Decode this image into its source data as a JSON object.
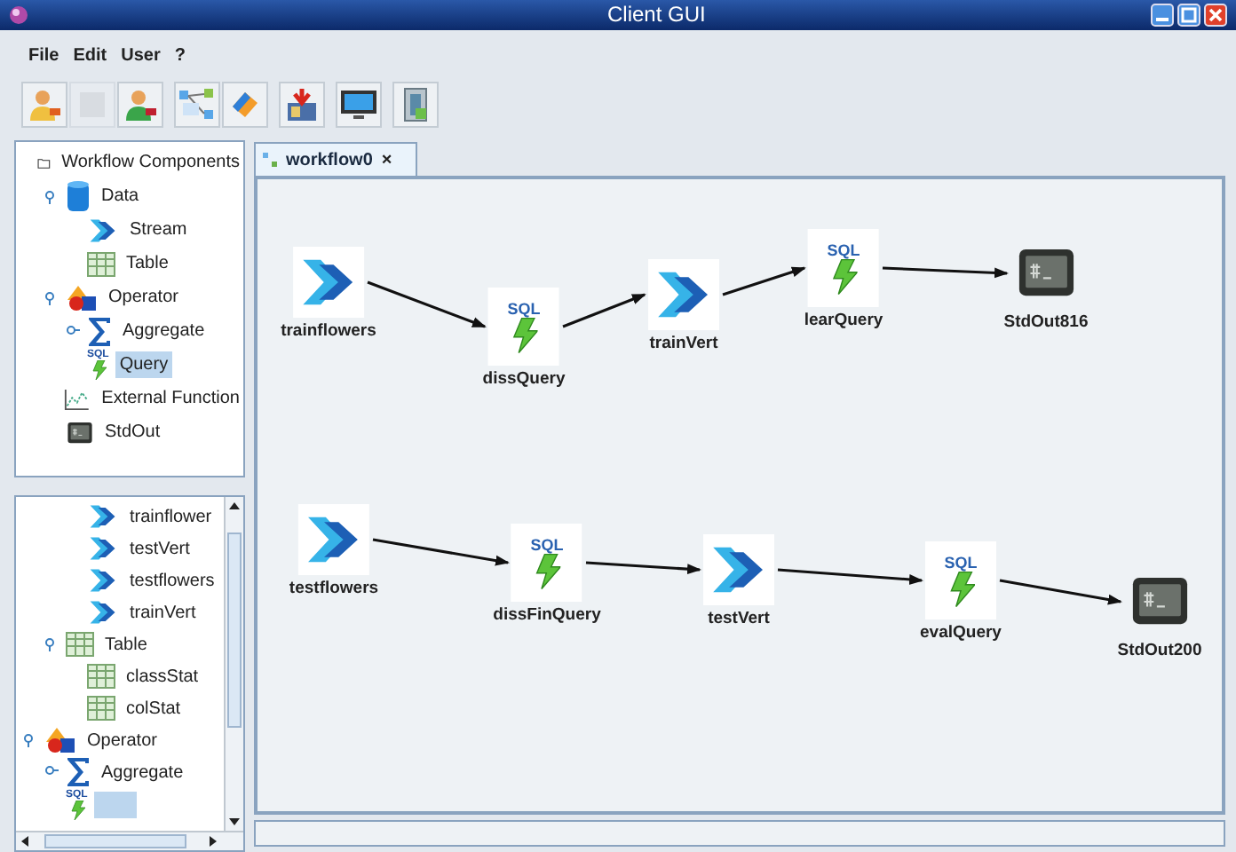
{
  "window": {
    "title": "Client GUI"
  },
  "menu": [
    "File",
    "Edit",
    "User",
    "?"
  ],
  "toolbar_groups": [
    {
      "buttons": [
        {
          "kind": "user-add",
          "disabled": false
        },
        {
          "kind": "blank",
          "disabled": true
        },
        {
          "kind": "user-remove",
          "disabled": false
        }
      ]
    },
    {
      "buttons": [
        {
          "kind": "workflow",
          "disabled": false
        },
        {
          "kind": "eraser",
          "disabled": false
        }
      ]
    },
    {
      "buttons": [
        {
          "kind": "import",
          "disabled": false
        }
      ]
    },
    {
      "buttons": [
        {
          "kind": "monitor",
          "disabled": false
        }
      ]
    },
    {
      "buttons": [
        {
          "kind": "server",
          "disabled": false
        }
      ]
    }
  ],
  "components_tree": {
    "items": [
      {
        "label": "Workflow Components",
        "kind": "folder",
        "selected": false,
        "children": [
          {
            "label": "Data",
            "kind": "database",
            "selected": false,
            "expanded": true,
            "children": [
              {
                "label": "Stream",
                "kind": "stream",
                "selected": false
              },
              {
                "label": "Table",
                "kind": "table",
                "selected": false
              }
            ]
          },
          {
            "label": "Operator",
            "kind": "operator",
            "selected": false,
            "expanded": true,
            "children": [
              {
                "label": "Aggregate",
                "kind": "sum",
                "selected": false,
                "expanded": false
              },
              {
                "label": "Query",
                "kind": "query",
                "badge": "SQL",
                "selected": true
              }
            ]
          },
          {
            "label": "External Function",
            "kind": "function",
            "selected": false
          },
          {
            "label": "StdOut",
            "kind": "stdout",
            "selected": false
          }
        ]
      }
    ]
  },
  "instances_tree": {
    "items": [
      {
        "kind": "continued",
        "children": [
          {
            "kind": "continued",
            "children": [
              {
                "kind": "stream",
                "label": "trainflower",
                "selected": false
              },
              {
                "kind": "stream",
                "label": "testVert",
                "selected": false
              },
              {
                "kind": "stream",
                "label": "testflowers",
                "selected": false
              },
              {
                "kind": "stream",
                "label": "trainVert",
                "selected": false
              }
            ]
          },
          {
            "kind": "table",
            "label": "Table",
            "selected": false,
            "expanded": true,
            "children": [
              {
                "kind": "table",
                "label": "classStat",
                "selected": false
              },
              {
                "kind": "table",
                "label": "colStat",
                "selected": false
              }
            ]
          }
        ]
      },
      {
        "kind": "operator",
        "label": "Operator",
        "selected": false,
        "expanded": true,
        "children": [
          {
            "kind": "sum",
            "label": "Aggregate",
            "selected": false,
            "expanded": false
          },
          {
            "kind": "query",
            "badge": "SQL",
            "selected": true
          }
        ]
      }
    ]
  },
  "tab": {
    "label": "workflow0",
    "close": "×",
    "selected": true
  },
  "workflow": {
    "rows": [
      {
        "nodes": [
          {
            "kind": "stream",
            "label": "trainflowers",
            "arrow_out": true
          },
          {
            "kind": "query",
            "badge": "SQL",
            "label": "dissQuery",
            "arrow_out": true
          },
          {
            "kind": "stream",
            "label": "trainVert",
            "arrow_out": true
          },
          {
            "kind": "query",
            "badge": "SQL",
            "label": "learQuery",
            "arrow_out": true
          },
          {
            "kind": "output",
            "label": "StdOut816",
            "arrow_out": false
          }
        ]
      },
      {
        "nodes": [
          {
            "kind": "stream",
            "label": "testflowers",
            "arrow_out": true
          },
          {
            "kind": "query",
            "badge": "SQL",
            "label": "dissFinQuery",
            "arrow_out": true
          },
          {
            "kind": "stream",
            "label": "testVert",
            "arrow_out": true
          },
          {
            "kind": "query",
            "badge": "SQL",
            "label": "evalQuery",
            "arrow_out": true
          },
          {
            "kind": "output",
            "label": "StdOut200",
            "arrow_out": false
          }
        ]
      }
    ]
  }
}
